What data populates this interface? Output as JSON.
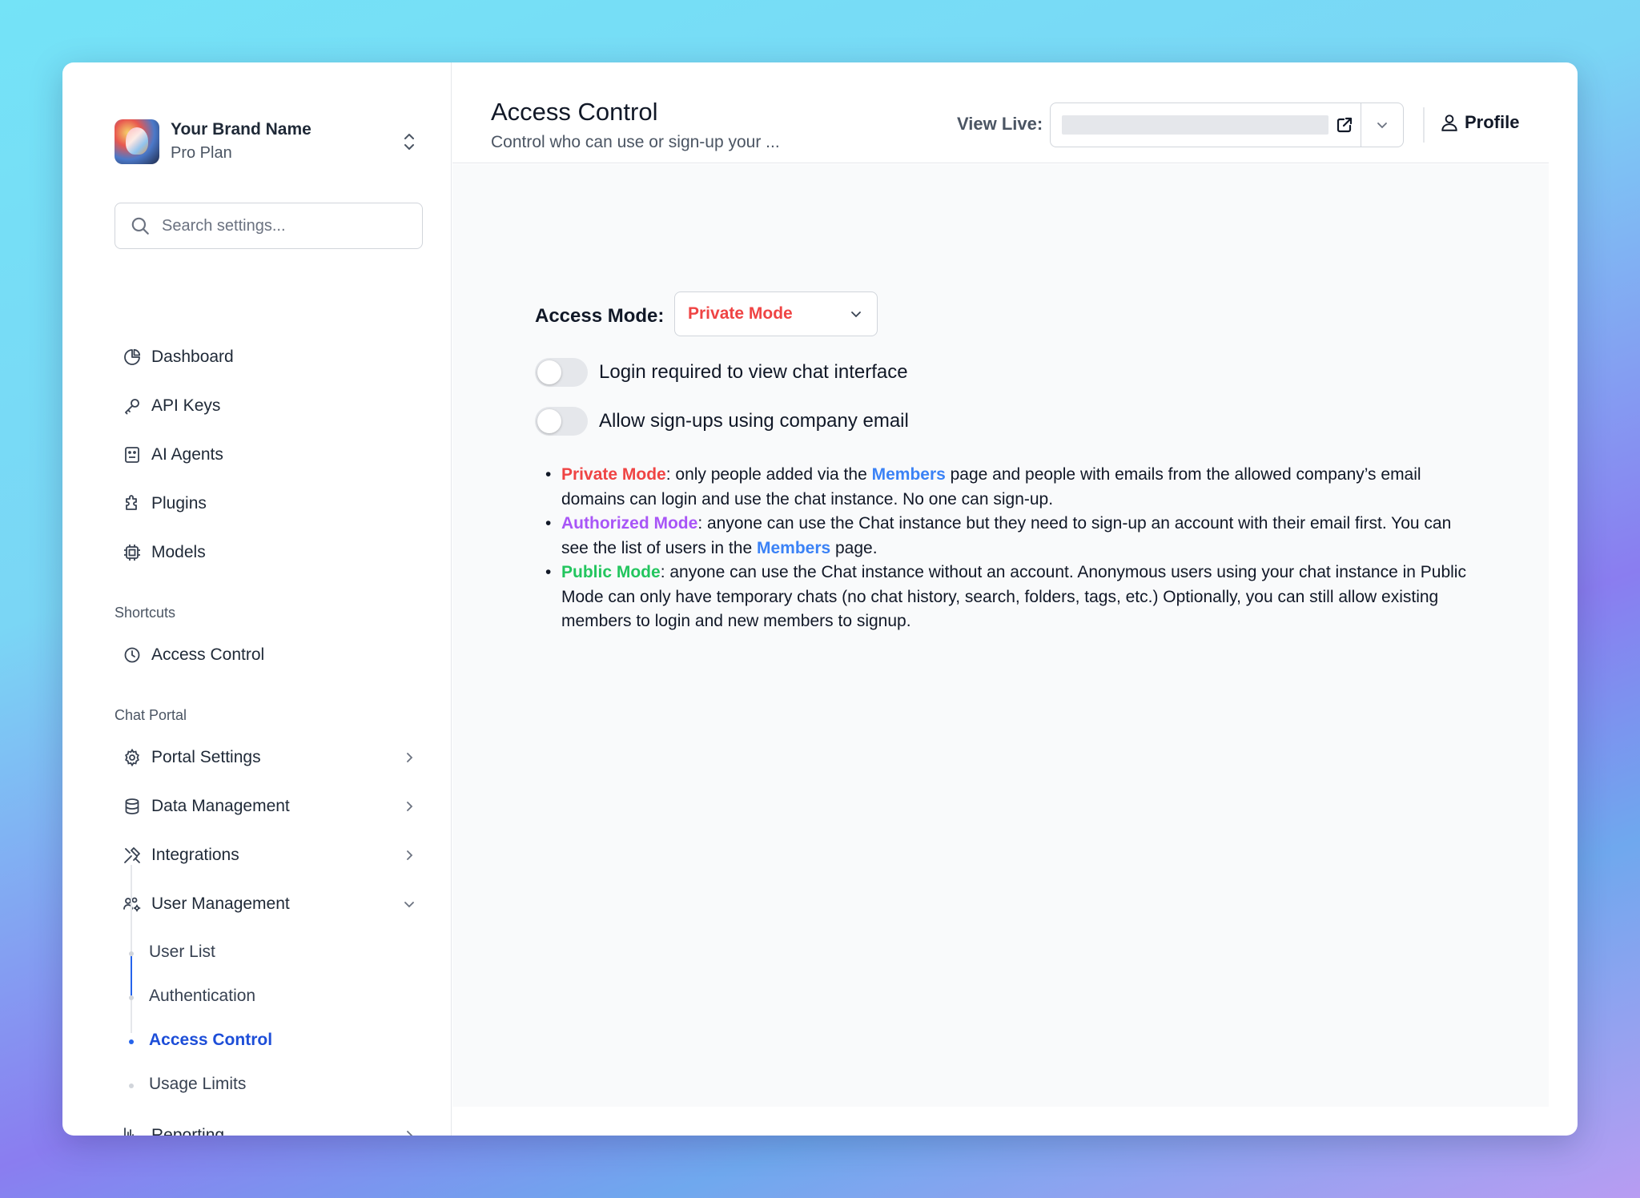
{
  "brand": {
    "name": "Your Brand Name",
    "plan": "Pro Plan"
  },
  "search": {
    "placeholder": "Search settings..."
  },
  "nav": {
    "main": [
      {
        "label": "Dashboard"
      },
      {
        "label": "API Keys"
      },
      {
        "label": "AI Agents"
      },
      {
        "label": "Plugins"
      },
      {
        "label": "Models"
      }
    ],
    "shortcuts_label": "Shortcuts",
    "shortcuts": [
      {
        "label": "Access Control"
      }
    ],
    "chat_portal_label": "Chat Portal",
    "chat_portal": [
      {
        "label": "Portal Settings"
      },
      {
        "label": "Data Management"
      },
      {
        "label": "Integrations"
      },
      {
        "label": "User Management"
      }
    ],
    "user_management_sub": [
      {
        "label": "User List"
      },
      {
        "label": "Authentication"
      },
      {
        "label": "Access Control"
      },
      {
        "label": "Usage Limits"
      }
    ],
    "reporting": {
      "label": "Reporting"
    }
  },
  "header": {
    "title": "Access Control",
    "subtitle": "Control who can use or sign-up your ...",
    "view_live_label": "View Live:",
    "profile_label": "Profile"
  },
  "main": {
    "access_mode_label": "Access Mode:",
    "access_mode_value": "Private Mode",
    "toggles": [
      {
        "label": "Login required to view chat interface",
        "on": false
      },
      {
        "label": "Allow sign-ups using company email",
        "on": false
      }
    ],
    "descriptions": {
      "private": {
        "name": "Private Mode",
        "t1": ": only people added via the ",
        "link": "Members",
        "t2": " page and people with emails from the allowed company’s email domains can login and use the chat instance. No one can sign-up."
      },
      "authorized": {
        "name": "Authorized Mode",
        "t1": ": anyone can use the Chat instance but they need to sign-up an account with their email first. You can see the list of users in the ",
        "link": "Members",
        "t2": " page."
      },
      "public": {
        "name": "Public Mode",
        "t1": ": anyone can use the Chat instance without an account. Anonymous users using your chat instance in Public Mode can only have temporary chats (no chat history, search, folders, tags, etc.) Optionally, you can still allow existing members to login and new members to signup."
      }
    }
  },
  "colors": {
    "private": "#ef4444",
    "authorized": "#a855f7",
    "public": "#22c55e",
    "link": "#3b82f6",
    "active_nav": "#1d4ed8"
  }
}
